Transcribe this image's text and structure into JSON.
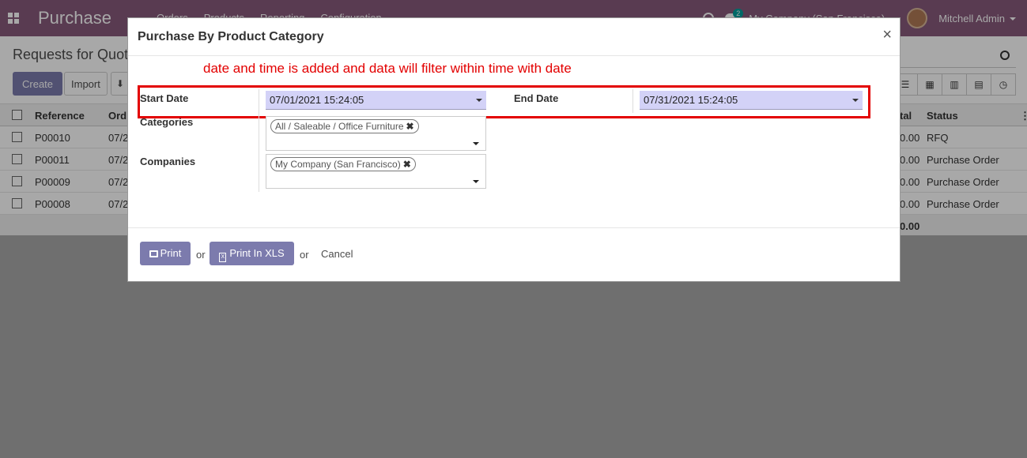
{
  "navbar": {
    "app_title": "Purchase",
    "menu": [
      "Orders",
      "Products",
      "Reporting",
      "Configuration"
    ],
    "chat_badge": "2",
    "company": "My Company (San Francisco)",
    "user": "Mitchell Admin"
  },
  "control_panel": {
    "breadcrumb": "Requests for Quot",
    "create_label": "Create",
    "import_label": "Import"
  },
  "list": {
    "headers": {
      "reference": "Reference",
      "order": "Ord",
      "total": "tal",
      "status": "Status"
    },
    "rows": [
      {
        "reference": "P00010",
        "order": "07/2",
        "total": "0.00",
        "status": "RFQ"
      },
      {
        "reference": "P00011",
        "order": "07/2",
        "total": "0.00",
        "status": "Purchase Order"
      },
      {
        "reference": "P00009",
        "order": "07/2",
        "total": "0.00",
        "status": "Purchase Order"
      },
      {
        "reference": "P00008",
        "order": "07/2",
        "total": "0.00",
        "status": "Purchase Order"
      }
    ],
    "grand_total": "0.00"
  },
  "modal": {
    "title": "Purchase By Product Category",
    "close": "×",
    "annotation": "date and time is added and data will filter within time with date",
    "start_date_label": "Start Date",
    "start_date_value": "07/01/2021 15:24:05",
    "end_date_label": "End Date",
    "end_date_value": "07/31/2021 15:24:05",
    "categories_label": "Categories",
    "categories_tag": "All / Saleable / Office Furniture",
    "companies_label": "Companies",
    "companies_tag": "My Company (San Francisco)",
    "print_label": "Print",
    "print_xls_label": "Print In XLS",
    "or_label": "or",
    "cancel_label": "Cancel"
  },
  "colors": {
    "brand": "#875a7b",
    "primary_button": "#7c7bad",
    "date_field_bg": "#d3d2f7",
    "annotation": "#e30000"
  }
}
